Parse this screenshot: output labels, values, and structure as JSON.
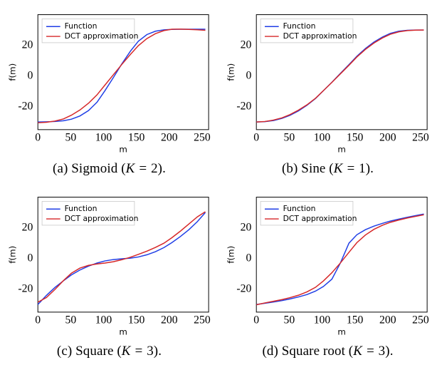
{
  "legend": {
    "function": "Function",
    "dct": "DCT approximation"
  },
  "axis_labels": {
    "x": "m",
    "y": "f(m)"
  },
  "captions": {
    "a_prefix": "(a) Sigmoid (",
    "b_prefix": "(b) Sine (",
    "c_prefix": "(c) Square (",
    "d_prefix": "(d) Square root (",
    "k_eq": "K = ",
    "a_k": "2",
    "b_k": "1",
    "c_k": "3",
    "d_k": "3",
    "suffix": ")."
  },
  "chart_data": [
    {
      "id": "a",
      "type": "line",
      "title": "Sigmoid (K=2)",
      "xlabel": "m",
      "ylabel": "f(m)",
      "xlim": [
        0,
        260
      ],
      "ylim": [
        -35,
        40
      ],
      "xticks": [
        0,
        50,
        100,
        150,
        200,
        250
      ],
      "yticks": [
        -20,
        0,
        20
      ],
      "legend": [
        "Function",
        "DCT approximation"
      ],
      "x": [
        0,
        13,
        26,
        39,
        51,
        64,
        77,
        90,
        102,
        115,
        128,
        141,
        153,
        166,
        179,
        192,
        204,
        217,
        230,
        243,
        255
      ],
      "series": [
        {
          "name": "Function",
          "values": [
            -30.0,
            -29.9,
            -29.7,
            -29.2,
            -28.2,
            -26.1,
            -22.6,
            -17.1,
            -9.7,
            -1.0,
            8.0,
            16.2,
            22.7,
            27.0,
            29.2,
            30.1,
            30.4,
            30.5,
            30.5,
            30.5,
            30.5
          ]
        },
        {
          "name": "DCT approximation",
          "values": [
            -30.5,
            -30.2,
            -29.4,
            -28.0,
            -25.6,
            -22.2,
            -17.8,
            -12.3,
            -6.0,
            0.8,
            7.6,
            14.1,
            19.8,
            24.4,
            27.6,
            29.6,
            30.5,
            30.6,
            30.4,
            30.1,
            29.8
          ]
        }
      ]
    },
    {
      "id": "b",
      "type": "line",
      "title": "Sine (K=1)",
      "xlabel": "m",
      "ylabel": "f(m)",
      "xlim": [
        0,
        260
      ],
      "ylim": [
        -35,
        40
      ],
      "xticks": [
        0,
        50,
        100,
        150,
        200,
        250
      ],
      "yticks": [
        -20,
        0,
        20
      ],
      "legend": [
        "Function",
        "DCT approximation"
      ],
      "x": [
        0,
        13,
        26,
        39,
        51,
        64,
        77,
        90,
        102,
        115,
        128,
        141,
        153,
        166,
        179,
        192,
        204,
        217,
        230,
        243,
        255
      ],
      "series": [
        {
          "name": "Function",
          "values": [
            -30.0,
            -29.8,
            -29.1,
            -27.7,
            -25.7,
            -22.8,
            -19.1,
            -14.7,
            -9.6,
            -4.1,
            1.7,
            7.4,
            12.9,
            17.9,
            22.1,
            25.4,
            27.8,
            29.2,
            29.8,
            30.0,
            30.0
          ]
        },
        {
          "name": "DCT approximation",
          "values": [
            -30.0,
            -29.7,
            -28.8,
            -27.3,
            -25.2,
            -22.3,
            -18.8,
            -14.5,
            -9.6,
            -4.2,
            1.4,
            7.0,
            12.4,
            17.3,
            21.5,
            24.8,
            27.2,
            28.8,
            29.6,
            29.9,
            30.0
          ]
        }
      ]
    },
    {
      "id": "c",
      "type": "line",
      "title": "Square (K=3)",
      "xlabel": "m",
      "ylabel": "f(m)",
      "xlim": [
        0,
        260
      ],
      "ylim": [
        -35,
        40
      ],
      "xticks": [
        0,
        50,
        100,
        150,
        200,
        250
      ],
      "yticks": [
        -20,
        0,
        20
      ],
      "legend": [
        "Function",
        "DCT approximation"
      ],
      "x": [
        0,
        13,
        26,
        39,
        51,
        64,
        77,
        90,
        102,
        115,
        128,
        141,
        153,
        166,
        179,
        192,
        204,
        217,
        230,
        243,
        255
      ],
      "series": [
        {
          "name": "Function",
          "values": [
            -30.0,
            -24.1,
            -18.9,
            -14.5,
            -10.7,
            -7.5,
            -5.0,
            -3.0,
            -1.6,
            -0.7,
            -0.2,
            0.2,
            1.0,
            2.4,
            4.4,
            7.1,
            10.3,
            14.3,
            18.8,
            24.1,
            30.0
          ]
        },
        {
          "name": "DCT approximation",
          "values": [
            -28.5,
            -25.5,
            -20.2,
            -14.4,
            -9.6,
            -6.3,
            -4.5,
            -3.6,
            -3.0,
            -2.1,
            -0.8,
            0.8,
            2.7,
            4.8,
            7.2,
            10.0,
            13.5,
            17.8,
            22.5,
            27.2,
            30.5
          ]
        }
      ]
    },
    {
      "id": "d",
      "type": "line",
      "title": "Square root (K=3)",
      "xlabel": "m",
      "ylabel": "f(m)",
      "xlim": [
        0,
        260
      ],
      "ylim": [
        -35,
        40
      ],
      "xticks": [
        0,
        50,
        100,
        150,
        200,
        250
      ],
      "yticks": [
        -20,
        0,
        20
      ],
      "legend": [
        "Function",
        "DCT approximation"
      ],
      "x": [
        0,
        13,
        26,
        39,
        51,
        64,
        77,
        90,
        102,
        115,
        128,
        141,
        153,
        166,
        179,
        192,
        204,
        217,
        230,
        243,
        255
      ],
      "series": [
        {
          "name": "Function",
          "values": [
            -30.0,
            -29.2,
            -28.4,
            -27.5,
            -26.4,
            -25.1,
            -23.5,
            -21.3,
            -18.3,
            -13.5,
            -2.9,
            10.0,
            15.5,
            18.8,
            21.1,
            22.9,
            24.4,
            25.7,
            26.9,
            28.0,
            29.0
          ]
        },
        {
          "name": "DCT approximation",
          "values": [
            -30.2,
            -29.0,
            -27.9,
            -26.8,
            -25.6,
            -24.0,
            -21.8,
            -18.8,
            -14.7,
            -9.3,
            -2.9,
            4.0,
            10.3,
            15.3,
            19.0,
            21.7,
            23.6,
            25.1,
            26.4,
            27.5,
            28.5
          ]
        }
      ]
    }
  ]
}
